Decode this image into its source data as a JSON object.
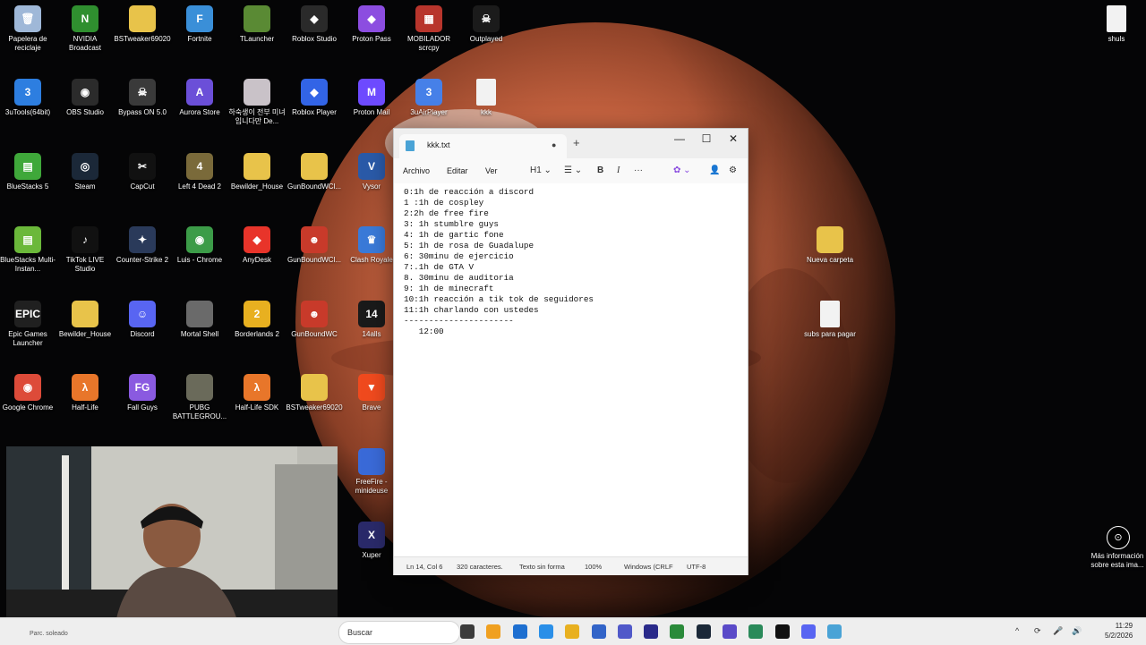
{
  "desktop": {
    "icons": [
      {
        "label": "Papelera de reciclaje",
        "color": "#9fb8d8",
        "glyph": "🗑"
      },
      {
        "label": "NVIDIA Broadcast",
        "color": "#2f8f2f",
        "glyph": "N"
      },
      {
        "label": "BSTweaker69020",
        "color": "#e8c34a",
        "glyph": ""
      },
      {
        "label": "Fortnite",
        "color": "#3a8fd8",
        "glyph": "F"
      },
      {
        "label": "TLauncher",
        "color": "#5a8a34",
        "glyph": ""
      },
      {
        "label": "Roblox Studio",
        "color": "#2a2a2a",
        "glyph": "◆"
      },
      {
        "label": "Proton Pass",
        "color": "#8c4de0",
        "glyph": "◆"
      },
      {
        "label": "MOBILADOR scrcpy",
        "color": "#b8352c",
        "glyph": "▦"
      },
      {
        "label": "Outplayed",
        "color": "#1b1b1b",
        "glyph": "☠"
      },
      {
        "label": "shuls",
        "color": "#f2f2f2",
        "glyph": ""
      },
      {
        "label": "3uTools(64bit)",
        "color": "#2d7ee0",
        "glyph": "3"
      },
      {
        "label": "OBS Studio",
        "color": "#2b2b2b",
        "glyph": "◉"
      },
      {
        "label": "Bypass ON 5.0",
        "color": "#3a3a3a",
        "glyph": "☠"
      },
      {
        "label": "Aurora Store",
        "color": "#6b4fd8",
        "glyph": "A"
      },
      {
        "label": "하숙생이 전부 미녀입니다만 De...",
        "color": "#c9c2c8",
        "glyph": ""
      },
      {
        "label": "Roblox Player",
        "color": "#3264e6",
        "glyph": "◆"
      },
      {
        "label": "Proton Mail",
        "color": "#6d4aff",
        "glyph": "M"
      },
      {
        "label": "3uAirPlayer",
        "color": "#4680e8",
        "glyph": "3"
      },
      {
        "label": "kkk",
        "color": "#f2f2f2",
        "glyph": ""
      },
      {
        "label": "BlueStacks 5",
        "color": "#3fa83a",
        "glyph": "▤"
      },
      {
        "label": "Steam",
        "color": "#1b2838",
        "glyph": "◎"
      },
      {
        "label": "CapCut",
        "color": "#111111",
        "glyph": "✂"
      },
      {
        "label": "Left 4 Dead 2",
        "color": "#7a6a3a",
        "glyph": "4"
      },
      {
        "label": "Bewilder_House",
        "color": "#e8c34a",
        "glyph": ""
      },
      {
        "label": "GunBoundWCl...",
        "color": "#e8c34a",
        "glyph": ""
      },
      {
        "label": "Vysor",
        "color": "#2a5aa8",
        "glyph": "V"
      },
      {
        "label": "BlueStacks Multi-Instan...",
        "color": "#6bb83a",
        "glyph": "▤"
      },
      {
        "label": "TikTok LIVE Studio",
        "color": "#111111",
        "glyph": "♪"
      },
      {
        "label": "Counter-Strike 2",
        "color": "#2a3a5a",
        "glyph": "✦"
      },
      {
        "label": "Luis - Chrome",
        "color": "#3c9c48",
        "glyph": "◉"
      },
      {
        "label": "AnyDesk",
        "color": "#e8342a",
        "glyph": "◆"
      },
      {
        "label": "GunBoundWCl...",
        "color": "#c83a2a",
        "glyph": "☻"
      },
      {
        "label": "Clash Royale",
        "color": "#3a7ad8",
        "glyph": "♛"
      },
      {
        "label": "Nueva carpeta",
        "color": "#e8c34a",
        "glyph": ""
      },
      {
        "label": "Epic Games Launcher",
        "color": "#202020",
        "glyph": "EPIC"
      },
      {
        "label": "Bewilder_House",
        "color": "#e8c34a",
        "glyph": ""
      },
      {
        "label": "Discord",
        "color": "#5865f2",
        "glyph": "☺"
      },
      {
        "label": "Mortal Shell",
        "color": "#6a6a6a",
        "glyph": ""
      },
      {
        "label": "Borderlands 2",
        "color": "#e8b020",
        "glyph": "2"
      },
      {
        "label": "GunBoundWC",
        "color": "#c83a2a",
        "glyph": "☻"
      },
      {
        "label": "14alls",
        "color": "#1a1a1a",
        "glyph": "14"
      },
      {
        "label": "subs para pagar",
        "color": "#f2f2f2",
        "glyph": ""
      },
      {
        "label": "Google Chrome",
        "color": "#dd4b39",
        "glyph": "◉"
      },
      {
        "label": "Half-Life",
        "color": "#e8762a",
        "glyph": "λ"
      },
      {
        "label": "Fall Guys",
        "color": "#8a5ae0",
        "glyph": "FG"
      },
      {
        "label": "PUBG BATTLEGROU...",
        "color": "#6a6a5a",
        "glyph": ""
      },
      {
        "label": "Half-Life SDK",
        "color": "#e8762a",
        "glyph": "λ"
      },
      {
        "label": "BSTweaker69020",
        "color": "#e8c34a",
        "glyph": ""
      },
      {
        "label": "Brave",
        "color": "#f04a1e",
        "glyph": "▼"
      },
      {
        "label": "FreeFire - minideuse",
        "color": "#3a6ad8",
        "glyph": ""
      },
      {
        "label": "Xuper",
        "color": "#2a2a6a",
        "glyph": "X"
      }
    ],
    "info_label": "Más información sobre esta ima..."
  },
  "notepad": {
    "tab_title": "kkk.txt",
    "tab_status": "●",
    "new_tab": "+",
    "win_minimize": "—",
    "win_maximize": "☐",
    "win_close": "✕",
    "menu": {
      "file": "Archivo",
      "edit": "Editar",
      "view": "Ver"
    },
    "toolbar": {
      "heading": "H1 ⌄",
      "list": "☰ ⌄",
      "bold": "B",
      "italic": "I",
      "more": "···",
      "copilot": "✿ ⌄",
      "account": "👤",
      "settings": "⚙"
    },
    "lines": [
      "0:1h de reacción a discord",
      "1 :1h de cospley",
      "2:2h de free fire",
      "3: 1h stumblre guys",
      "4: 1h de gartic fone",
      "5: 1h de rosa de Guadalupe",
      "6: 30minu de ejercicio",
      "7:.1h de GTA V",
      "8. 30minu de auditoria",
      "9: 1h de minecraft",
      "10:1h reacción a tik tok de seguidores",
      "11:1h charlando con ustedes",
      "----------------------",
      "   12:00"
    ],
    "status": {
      "position": "Ln 14, Col 6",
      "chars": "320 caracteres.",
      "format": "Texto sin forma",
      "zoom": "100%",
      "eol": "Windows (CRLF",
      "encoding": "UTF-8"
    }
  },
  "taskbar": {
    "search_placeholder": "Buscar",
    "weather": "Parc. soleado",
    "time": "11:29",
    "date": "5/2/2026",
    "apps": [
      "#3b3b3b",
      "#f0a020",
      "#1e6fd0",
      "#2a8fe8",
      "#e8b020",
      "#3264c8",
      "#5059c9",
      "#2a2a8a",
      "#2a8a3a",
      "#1b2838",
      "#5a4ac8",
      "#2a8a5a",
      "#111111",
      "#5865f2",
      "#4aa3d6"
    ],
    "tray": [
      "^",
      "⟳",
      "🎤",
      "🔊"
    ]
  }
}
